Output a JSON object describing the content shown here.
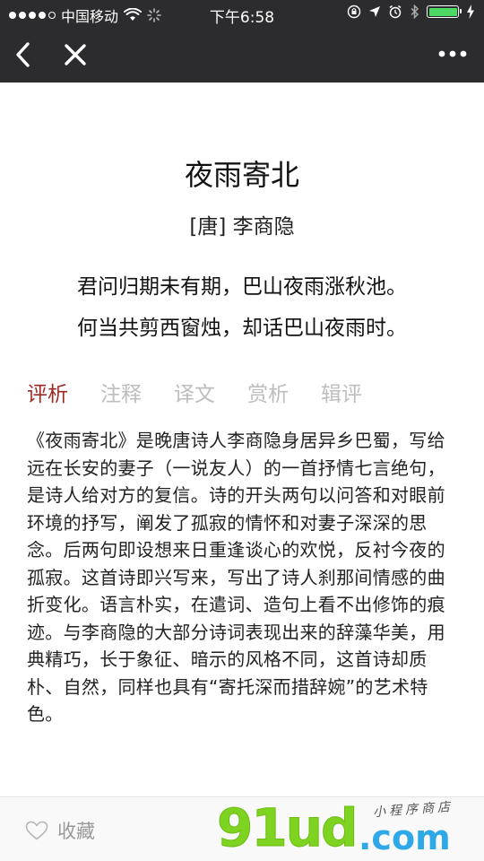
{
  "status_bar": {
    "carrier": "中国移动",
    "time": "下午6:58",
    "signal_icon": "signal-dots-icon",
    "wifi_icon": "wifi-icon",
    "battery_color": "#4cd964"
  },
  "nav": {
    "back_icon": "chevron-left-icon",
    "close_icon": "close-icon",
    "more_icon": "more-dots-icon"
  },
  "poem": {
    "title": "夜雨寄北",
    "author": "[唐] 李商隐",
    "lines": [
      "君问归期未有期，巴山夜雨涨秋池。",
      "何当共剪西窗烛，却话巴山夜雨时。"
    ]
  },
  "tabs": [
    {
      "label": "评析",
      "active": true
    },
    {
      "label": "注释",
      "active": false
    },
    {
      "label": "译文",
      "active": false
    },
    {
      "label": "赏析",
      "active": false
    },
    {
      "label": "辑评",
      "active": false
    }
  ],
  "analysis": {
    "text": "《夜雨寄北》是晚唐诗人李商隐身居异乡巴蜀，写给远在长安的妻子（一说友人）的一首抒情七言绝句，是诗人给对方的复信。诗的开头两句以问答和对眼前环境的抒写，阐发了孤寂的情怀和对妻子深深的思念。后两句即设想来日重逢谈心的欢悦，反衬今夜的孤寂。这首诗即兴写来，写出了诗人刹那间情感的曲折变化。语言朴实，在遣词、造句上看不出修饰的痕迹。与李商隐的大部分诗词表现出来的辞藻华美，用典精巧，长于象征、暗示的风格不同，这首诗却质朴、自然，同样也具有“寄托深而措辞婉”的艺术特色。"
  },
  "bottom_bar": {
    "favorite_label": "收藏",
    "favorite_icon": "heart-outline-icon"
  },
  "watermark": {
    "main": "91ud",
    "dotcom": ".com",
    "sub": "小程序商店"
  },
  "colors": {
    "topbar_bg": "#2c2c2e",
    "active_tab": "#9b2a25",
    "inactive_tab": "#bdbdbd",
    "watermark_green": "#7dd320",
    "watermark_blue": "#2fa8e8"
  }
}
